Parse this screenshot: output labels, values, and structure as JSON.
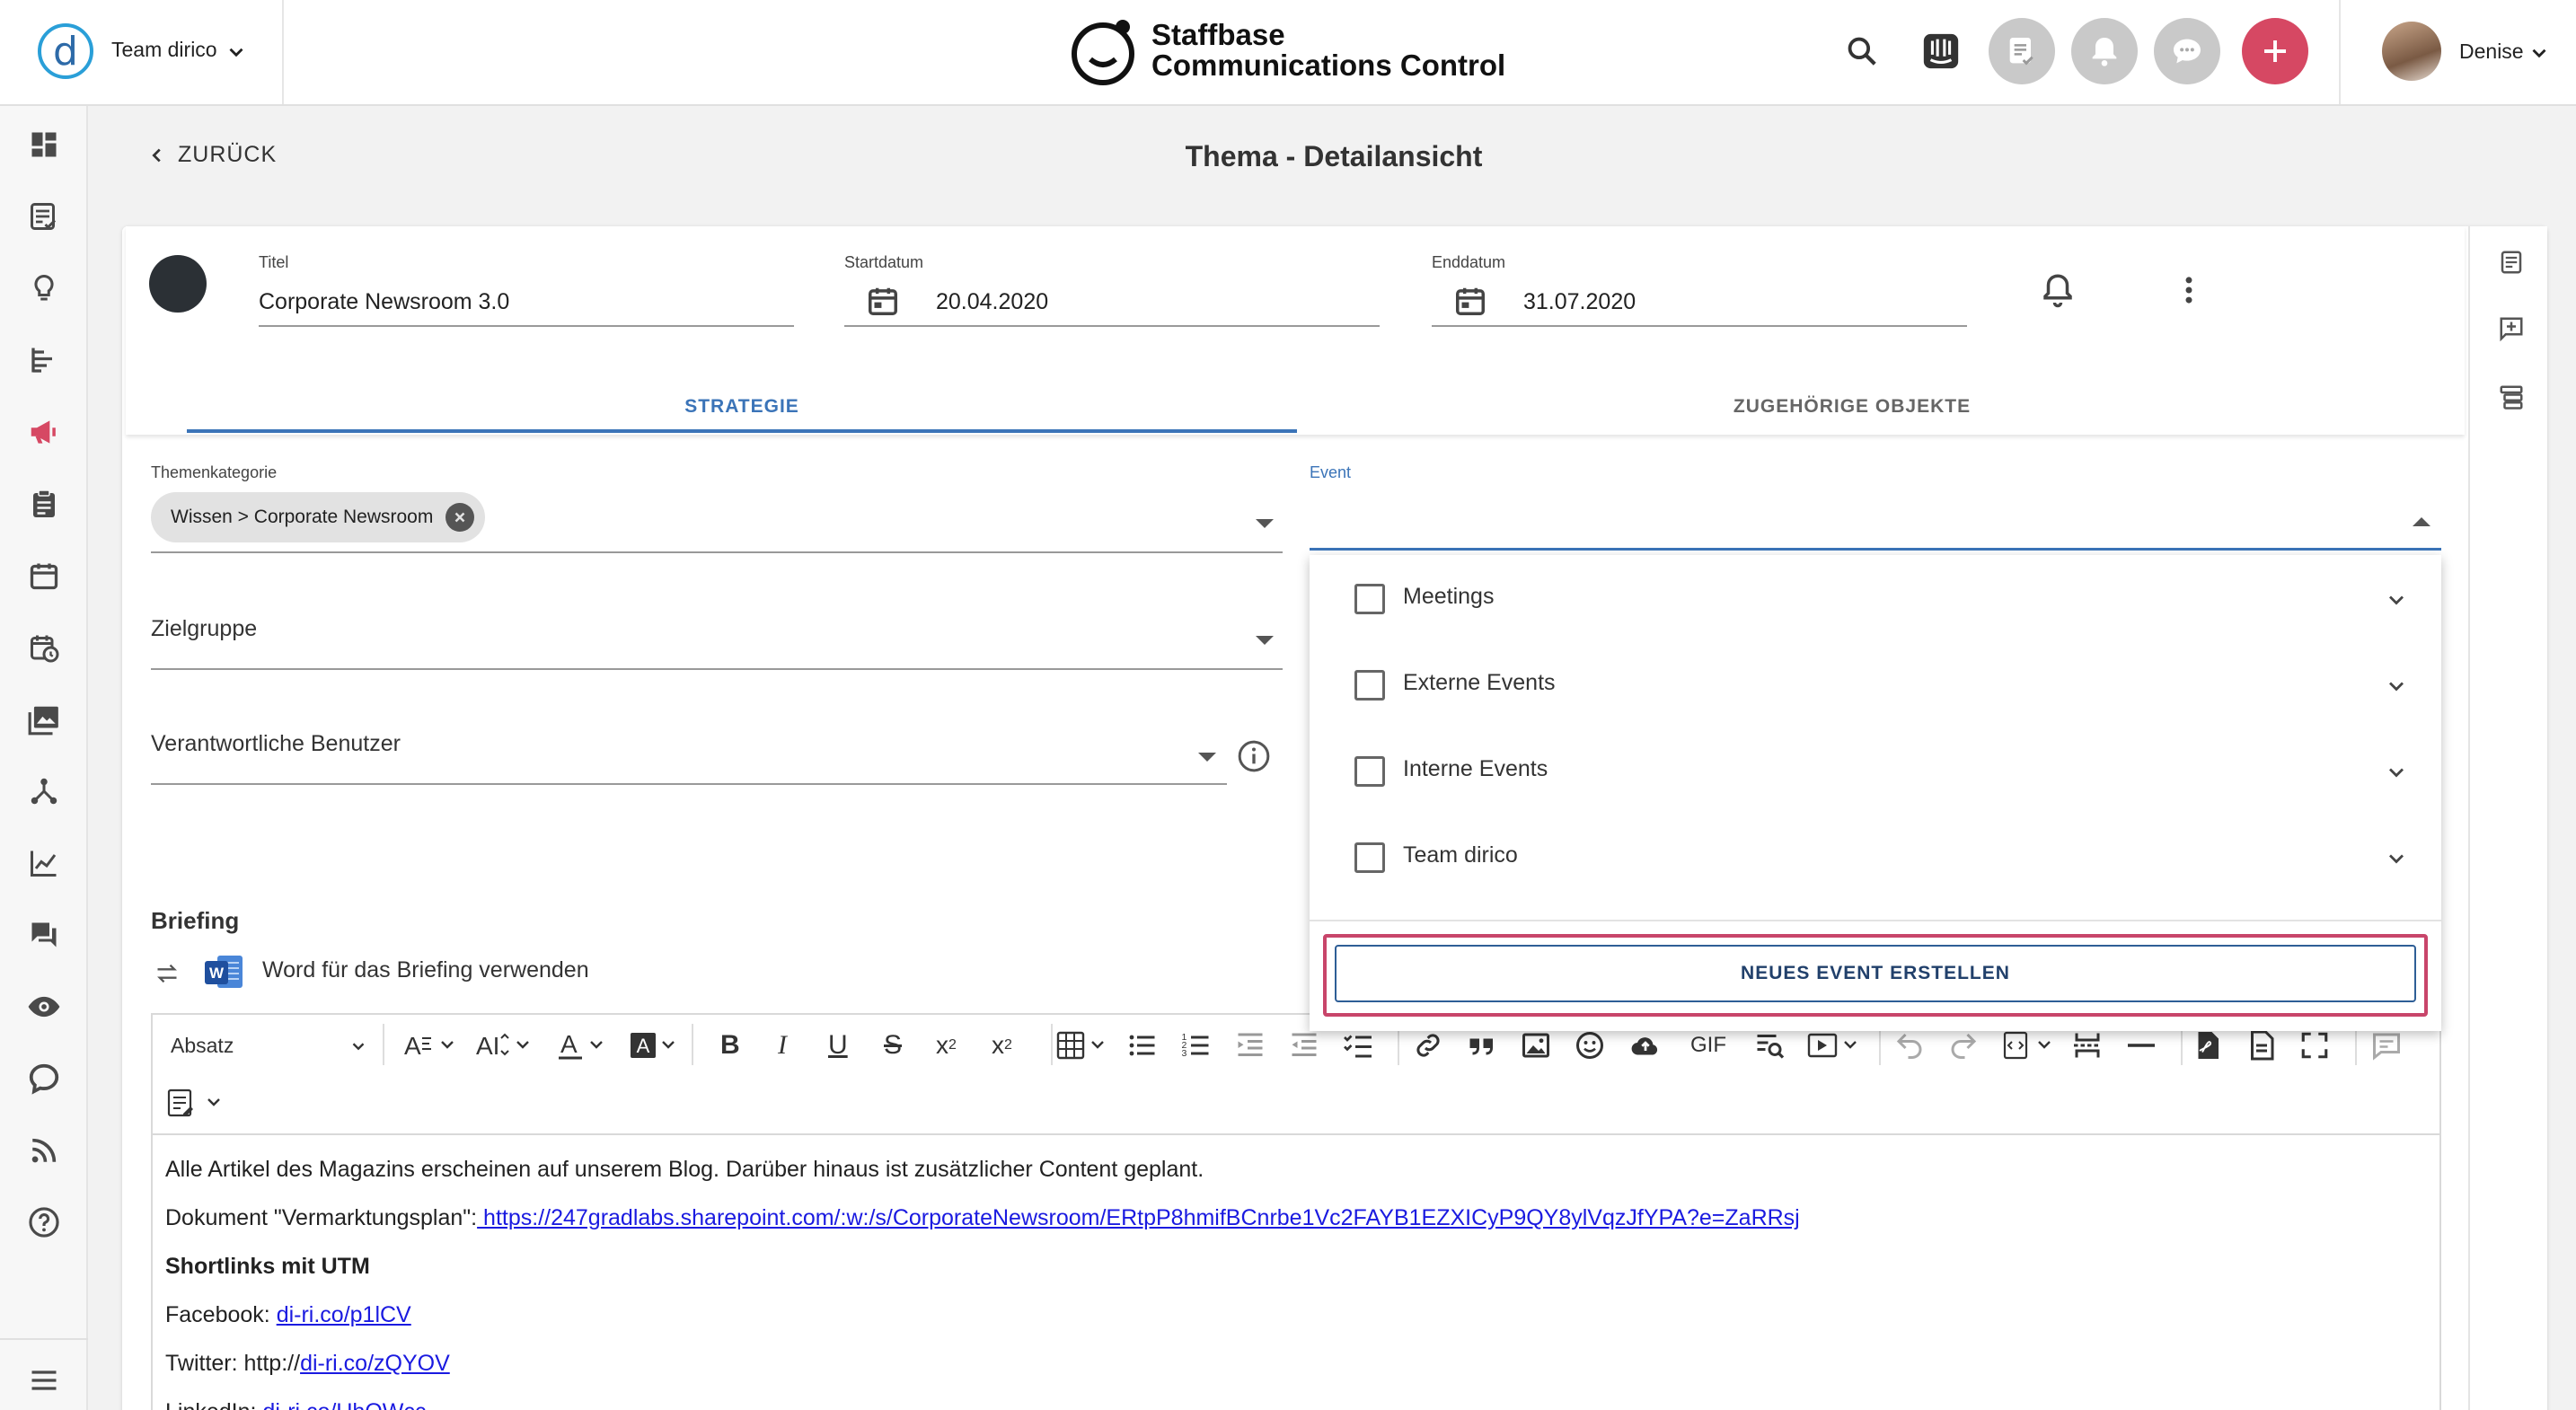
{
  "topbar": {
    "team_name": "Team dirico",
    "brand_line1": "Staffbase",
    "brand_line2": "Communications Control",
    "user_name": "Denise",
    "icons": [
      "search-icon",
      "intercom-icon",
      "tasks-icon",
      "bell-icon",
      "chat-icon",
      "add-icon"
    ],
    "accent_color": "#d64863"
  },
  "sidebar": {
    "items": [
      "dashboard-icon",
      "tasks-icon",
      "idea-icon",
      "timeline-icon",
      "campaign-icon",
      "clipboard-icon",
      "calendar-icon",
      "schedule-icon",
      "media-icon",
      "network-icon",
      "analytics-icon",
      "chat-icon",
      "eye-icon",
      "cloud-icon",
      "rss-icon",
      "help-icon",
      "menu-icon"
    ]
  },
  "subheader": {
    "back_label": "ZURÜCK",
    "page_title": "Thema - Detailansicht"
  },
  "topic": {
    "title_label": "Titel",
    "title_value": "Corporate Newsroom 3.0",
    "start_label": "Startdatum",
    "start_value": "20.04.2020",
    "end_label": "Enddatum",
    "end_value": "31.07.2020"
  },
  "tabs": {
    "strategy": "STRATEGIE",
    "related": "ZUGEHÖRIGE OBJEKTE"
  },
  "form": {
    "category_label": "Themenkategorie",
    "category_chip": "Wissen > Corporate Newsroom",
    "audience_label": "Zielgruppe",
    "responsible_label": "Verantwortliche Benutzer",
    "event_label": "Event"
  },
  "event_dropdown": {
    "options": [
      "Meetings",
      "Externe Events",
      "Interne Events",
      "Team dirico"
    ],
    "create_button": "NEUES EVENT ERSTELLEN"
  },
  "briefing": {
    "title": "Briefing",
    "word_label": "Word für das Briefing verwenden",
    "format_select": "Absatz",
    "gif_label": "GIF",
    "content": {
      "line1": "Alle Artikel des Magazins erscheinen auf unserem Blog. Darüber hinaus ist zusätzlicher Content geplant.",
      "line2_prefix": "Dokument \"Vermarktungsplan\":",
      "line2_link": " https://247gradlabs.sharepoint.com/:w:/s/CorporateNewsroom/ERtpP8hmifBCnrbe1Vc2FAYB1EZXICyP9QY8ylVqzJfYPA?e=ZaRRsj",
      "line3": "Shortlinks mit UTM",
      "line4_prefix": "Facebook: ",
      "line4_link": "di-ri.co/p1lCV",
      "line5_prefix": "Twitter: http://",
      "line5_link": "di-ri.co/zQYOV",
      "line6_prefix": "LinkedIn: ",
      "line6_link": "di-ri.co/UhOWcc"
    }
  }
}
